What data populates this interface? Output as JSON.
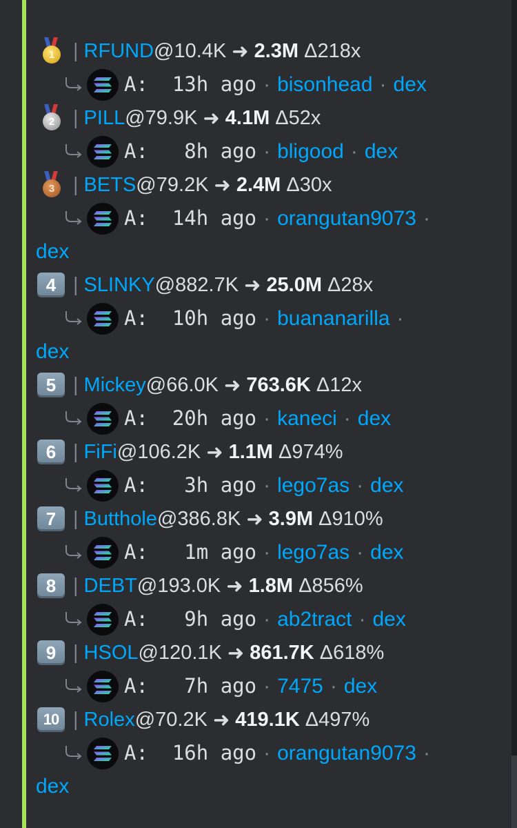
{
  "entries": [
    {
      "rank": "1",
      "badge": "gold-medal",
      "ticker": "RFUND",
      "entry_mc": "10.4K",
      "ath_mc": "2.3M",
      "gain": "218x",
      "age": "13h",
      "caller": "bisonhead",
      "link": "dex"
    },
    {
      "rank": "2",
      "badge": "silver-medal",
      "ticker": "PILL",
      "entry_mc": "79.9K",
      "ath_mc": "4.1M",
      "gain": "52x",
      "age": "8h",
      "caller": "bligood",
      "link": "dex"
    },
    {
      "rank": "3",
      "badge": "bronze-medal",
      "ticker": "BETS",
      "entry_mc": "79.2K",
      "ath_mc": "2.4M",
      "gain": "30x",
      "age": "14h",
      "caller": "orangutan9073",
      "link": "dex"
    },
    {
      "rank": "4",
      "badge": "keycap",
      "ticker": "SLINKY",
      "entry_mc": "882.7K",
      "ath_mc": "25.0M",
      "gain": "28x",
      "age": "10h",
      "caller": "buananarilla",
      "link": "dex"
    },
    {
      "rank": "5",
      "badge": "keycap",
      "ticker": "Mickey",
      "entry_mc": "66.0K",
      "ath_mc": "763.6K",
      "gain": "12x",
      "age": "20h",
      "caller": "kaneci",
      "link": "dex"
    },
    {
      "rank": "6",
      "badge": "keycap",
      "ticker": "FiFi",
      "entry_mc": "106.2K",
      "ath_mc": "1.1M",
      "gain": "974%",
      "age": "3h",
      "caller": "lego7as",
      "link": "dex"
    },
    {
      "rank": "7",
      "badge": "keycap",
      "ticker": "Butthole",
      "entry_mc": "386.8K",
      "ath_mc": "3.9M",
      "gain": "910%",
      "age": "1m",
      "caller": "lego7as",
      "link": "dex"
    },
    {
      "rank": "8",
      "badge": "keycap",
      "ticker": "DEBT",
      "entry_mc": "193.0K",
      "ath_mc": "1.8M",
      "gain": "856%",
      "age": "9h",
      "caller": "ab2tract",
      "link": "dex"
    },
    {
      "rank": "9",
      "badge": "keycap",
      "ticker": "HSOL",
      "entry_mc": "120.1K",
      "ath_mc": "861.7K",
      "gain": "618%",
      "age": "7h",
      "caller": "7475",
      "link": "dex"
    },
    {
      "rank": "10",
      "badge": "keycap",
      "ticker": "Rolex",
      "entry_mc": "70.2K",
      "ath_mc": "419.1K",
      "gain": "497%",
      "age": "16h",
      "caller": "orangutan9073",
      "link": "dex"
    }
  ],
  "labels": {
    "separator": "|",
    "at": "@",
    "arrow": "➜",
    "delta": "Δ",
    "agent_prefix": "A:",
    "ago": "ago",
    "dot": "·"
  },
  "colors": {
    "background": "#2b2d31",
    "accent_bar": "#a6e35a",
    "link": "#00a8fc",
    "text": "#dbdee1"
  }
}
